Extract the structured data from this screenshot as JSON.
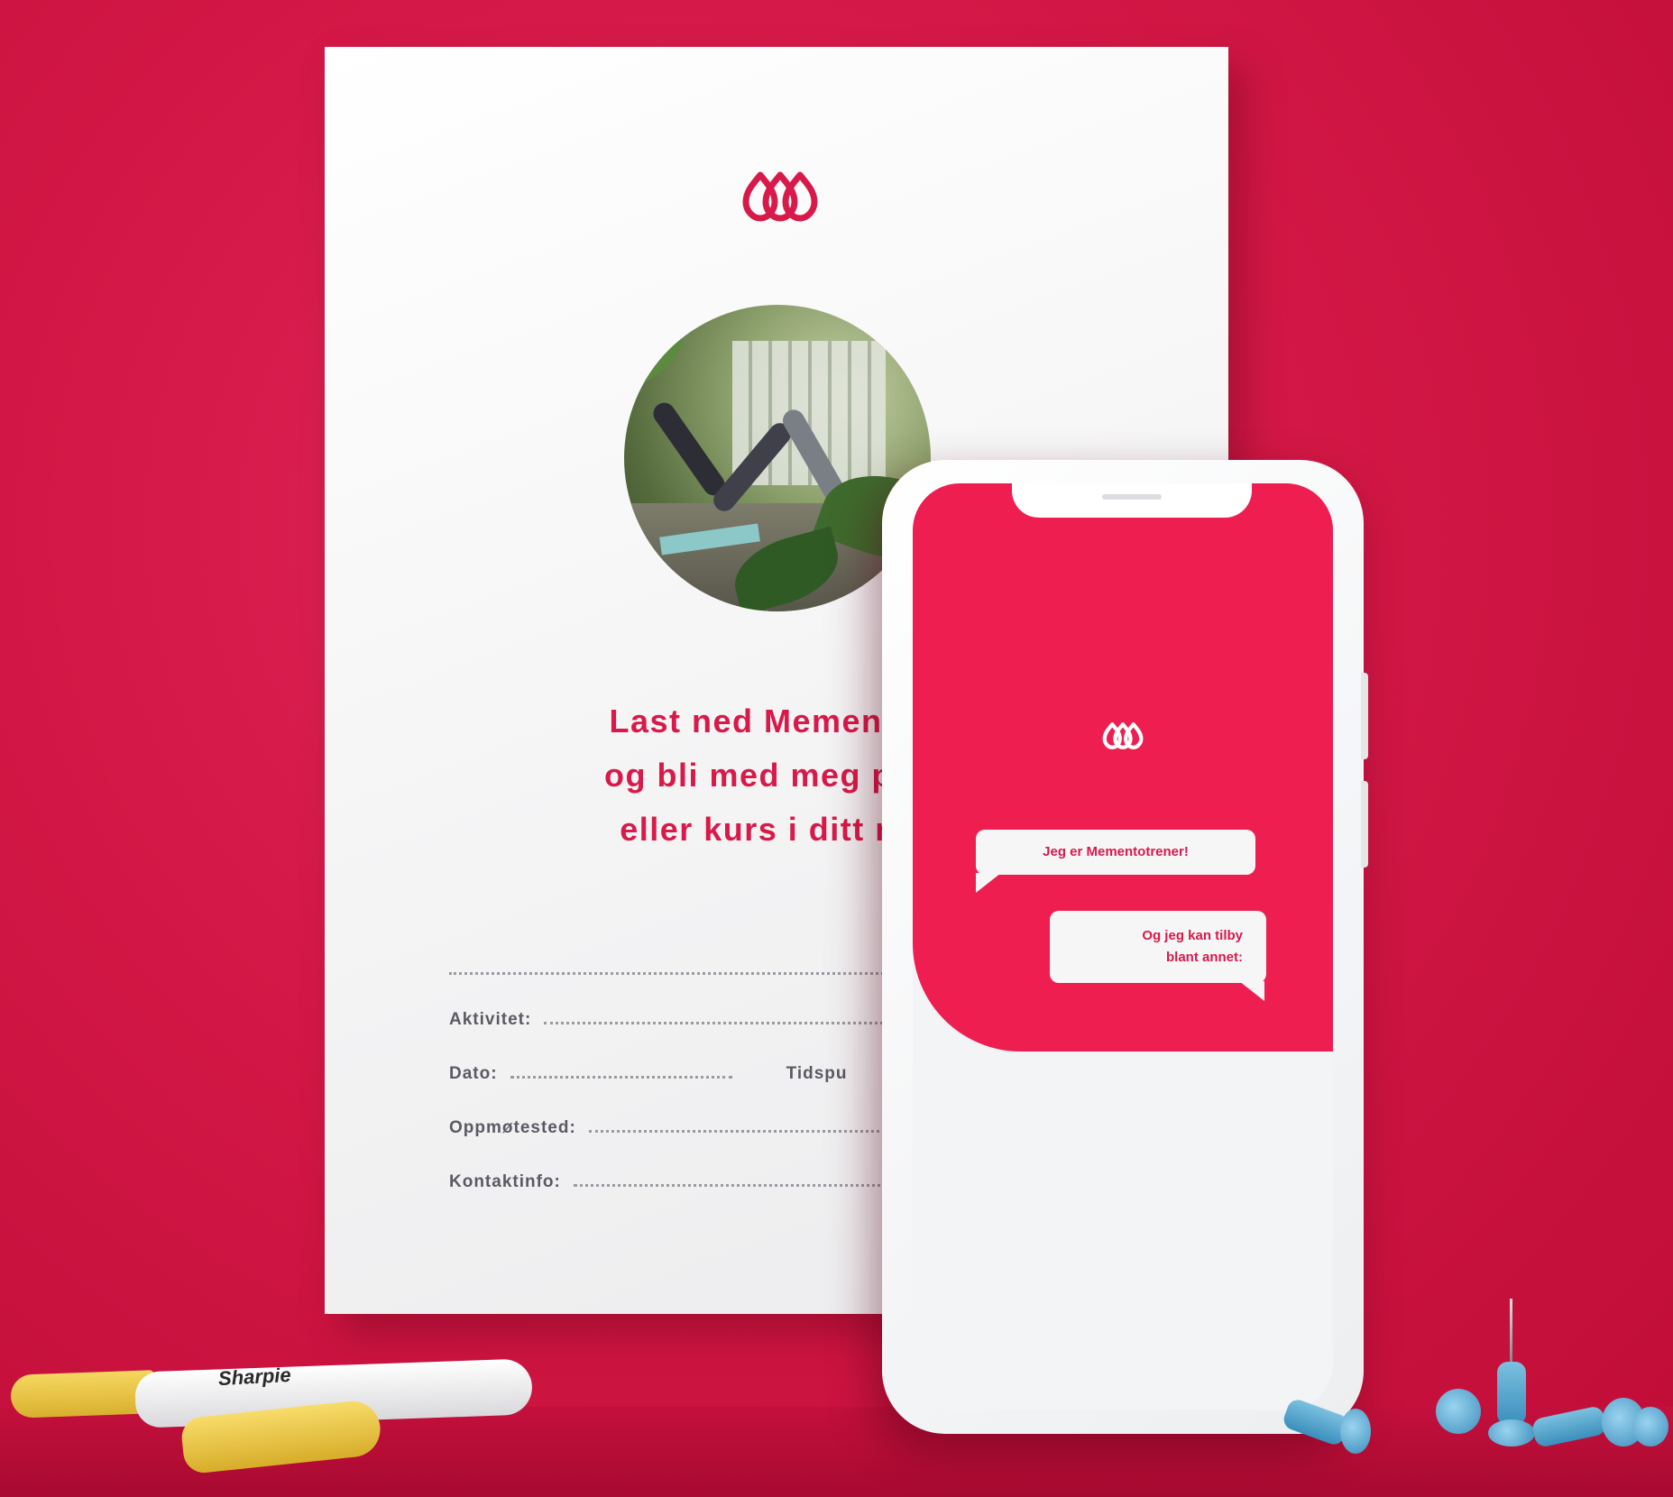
{
  "poster": {
    "logo_icon": "memento-logo-icon",
    "headline": [
      "Last ned Memento U",
      "og bli med meg på tu",
      "eller kurs i ditt nær"
    ],
    "fields": {
      "activity": "Aktivitet:",
      "date": "Dato:",
      "time": "Tidspu",
      "meeting_place": "Oppmøtested:",
      "contact": "Kontaktinfo:"
    }
  },
  "phone": {
    "logo_icon": "memento-logo-icon",
    "bubble1": "Jeg er Mementotrener!",
    "bubble2_line1": "Og jeg kan tilby",
    "bubble2_line2": "blant annet:"
  },
  "marker": {
    "brand": "Sharpie"
  },
  "colors": {
    "brand": "#ee1e50",
    "background": "#d31746",
    "headline": "#d81a4a"
  }
}
